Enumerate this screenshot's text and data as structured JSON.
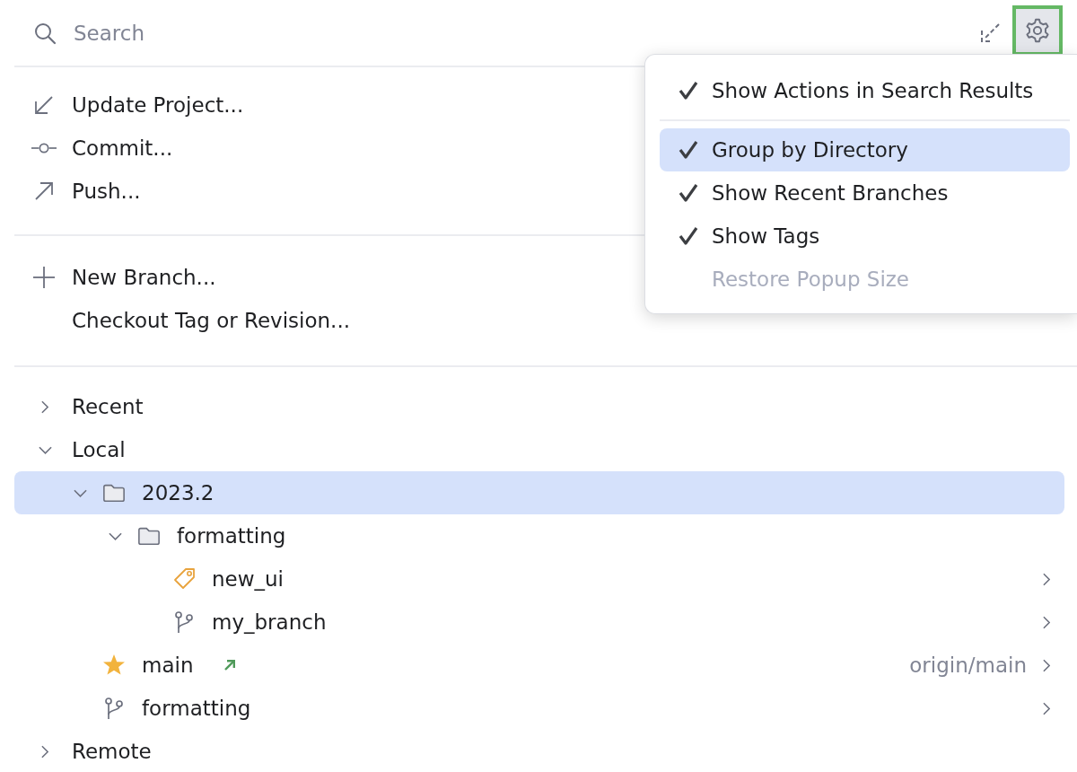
{
  "search": {
    "placeholder": "Search"
  },
  "settings_button": {
    "highlighted": true
  },
  "action_groups": [
    [
      {
        "label": "Update Project...",
        "kind": "update"
      },
      {
        "label": "Commit...",
        "kind": "commit"
      },
      {
        "label": "Push...",
        "kind": "push"
      }
    ],
    [
      {
        "label": "New Branch...",
        "kind": "new_branch"
      },
      {
        "label": "Checkout Tag or Revision...",
        "kind": "checkout"
      }
    ]
  ],
  "tree": [
    {
      "label": "Recent",
      "kind": "group",
      "expanded": false,
      "selected": false
    },
    {
      "label": "Local",
      "kind": "group",
      "expanded": true,
      "selected": false,
      "children": [
        {
          "label": "2023.2",
          "kind": "folder",
          "expanded": true,
          "selected": true,
          "children": [
            {
              "label": "formatting",
              "kind": "folder",
              "expanded": true,
              "selected": false,
              "children": [
                {
                  "label": "new_ui",
                  "kind": "tag",
                  "selected": false
                },
                {
                  "label": "my_branch",
                  "kind": "branch",
                  "selected": false
                }
              ]
            }
          ]
        },
        {
          "label": "main",
          "kind": "branch",
          "selected": false,
          "favorite": true,
          "outgoing": true,
          "tracking": "origin/main"
        },
        {
          "label": "formatting",
          "kind": "branch",
          "selected": false
        }
      ]
    },
    {
      "label": "Remote",
      "kind": "group",
      "expanded": false,
      "selected": false
    }
  ],
  "settings_menu": {
    "groups": [
      {
        "items": [
          {
            "label": "Show Actions in Search Results",
            "checked": true,
            "selected": false,
            "disabled": false
          }
        ]
      },
      {
        "items": [
          {
            "label": "Group by Directory",
            "checked": true,
            "selected": true,
            "disabled": false
          },
          {
            "label": "Show Recent Branches",
            "checked": true,
            "selected": false,
            "disabled": false
          },
          {
            "label": "Show Tags",
            "checked": true,
            "selected": false,
            "disabled": false
          },
          {
            "label": "Restore Popup Size",
            "checked": false,
            "selected": false,
            "disabled": true
          }
        ]
      }
    ]
  }
}
